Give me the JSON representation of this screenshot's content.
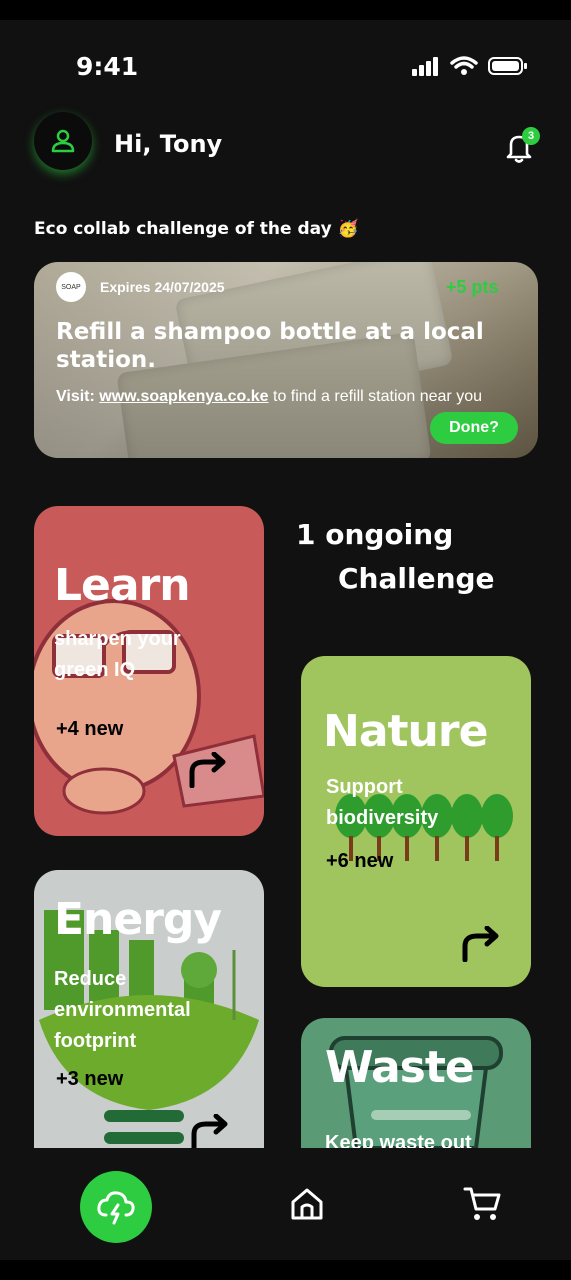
{
  "status_bar": {
    "time": "9:41"
  },
  "header": {
    "greeting": "Hi, Tony",
    "notification_count": "3"
  },
  "section": {
    "title": "Eco collab challenge of the day 🥳"
  },
  "challenge": {
    "logo_text": "SOAP",
    "expires": "Expires 24/07/2025",
    "points": "+5 pts",
    "title": "Refill a shampoo bottle at a local station.",
    "desc_prefix": "Visit: ",
    "desc_link": "www.soapkenya.co.ke",
    "desc_suffix": " to find a refill station near you",
    "done_label": "Done?"
  },
  "ongoing": {
    "line1": "1 ongoing",
    "line2": "Challenge"
  },
  "categories": [
    {
      "title": "Learn",
      "subtitle": "sharpen your green IQ",
      "new_count": "+4 new",
      "color": "#c85a5a"
    },
    {
      "title": "Nature",
      "subtitle": "Support biodiversity",
      "new_count": "+6 new",
      "color": "#a0c45e"
    },
    {
      "title": "Energy",
      "subtitle": "Reduce environmental footprint",
      "new_count": "+3 new",
      "color": "#c9cdcb"
    },
    {
      "title": "Waste",
      "subtitle": "Keep waste out",
      "new_count": "",
      "color": "#5a9a74"
    }
  ],
  "nav": {
    "items": [
      "eco-action-icon",
      "home-icon",
      "cart-icon"
    ],
    "accent": "#2ecc40"
  }
}
